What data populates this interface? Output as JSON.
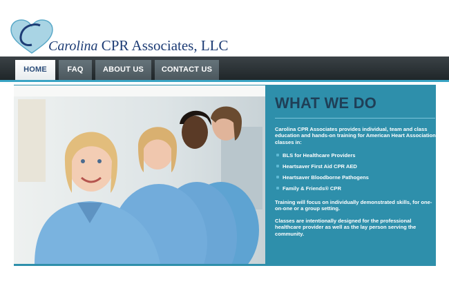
{
  "logo": {
    "script_text": "Carolina",
    "rest_text": " CPR Associates, LLC",
    "icon": "heart-logo-icon"
  },
  "nav": {
    "items": [
      {
        "label": "HOME",
        "active": true
      },
      {
        "label": "FAQ",
        "active": false
      },
      {
        "label": "ABOUT US",
        "active": false
      },
      {
        "label": "CONTACT US",
        "active": false
      }
    ]
  },
  "hero": {
    "image": "photo-nurses"
  },
  "what_we_do": {
    "heading": "WHAT WE DO",
    "intro": "Carolina CPR Associates provides individual, team and class education and hands-on training for American Heart Association classes in:",
    "services": [
      "BLS for Healthcare Providers",
      "Heartsaver First Aid CPR AED",
      "Heartsaver Bloodborne Pathogens",
      "Family & Friends® CPR"
    ],
    "para2": "Training will focus on individually demonstrated skills, for one-on-one or a group setting.",
    "para3": "Classes are intentionally designed for the professional healthcare provider as well as the lay person serving the community."
  },
  "colors": {
    "brand_navy": "#1d3c75",
    "panel_teal": "#2e8fab",
    "nav_dark": "#2a3134",
    "accent_blue": "#39a4c4"
  }
}
